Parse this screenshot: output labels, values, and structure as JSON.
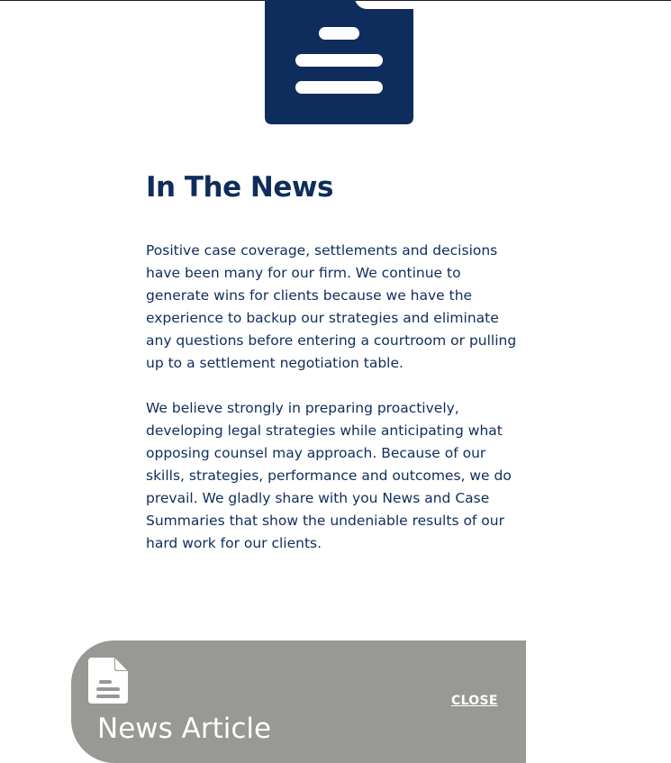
{
  "colors": {
    "brand_navy": "#0f2d5c",
    "card_gray": "#989894",
    "card_text": "#ffffff"
  },
  "hero": {
    "icon": "document-icon"
  },
  "section": {
    "heading": "In The News",
    "paragraphs": [
      "Positive case coverage, settlements and decisions\nhave been many for our firm.  We continue to\ngenerate wins for clients because we have the\nexperience to backup our strategies and eliminate\nany questions before entering a courtroom or pulling\nup to a settlement negotiation table.",
      "We believe strongly in preparing proactively,\ndeveloping legal strategies while anticipating what\nopposing counsel may approach.  Because of our\nskills, strategies, performance and outcomes, we do\nprevail. We gladly share with you News and Case\nSummaries that show the undeniable results of our\nhard work for our clients."
    ]
  },
  "news_card": {
    "icon": "file-text-icon",
    "title": "News Article",
    "close_label": "CLOSE"
  }
}
